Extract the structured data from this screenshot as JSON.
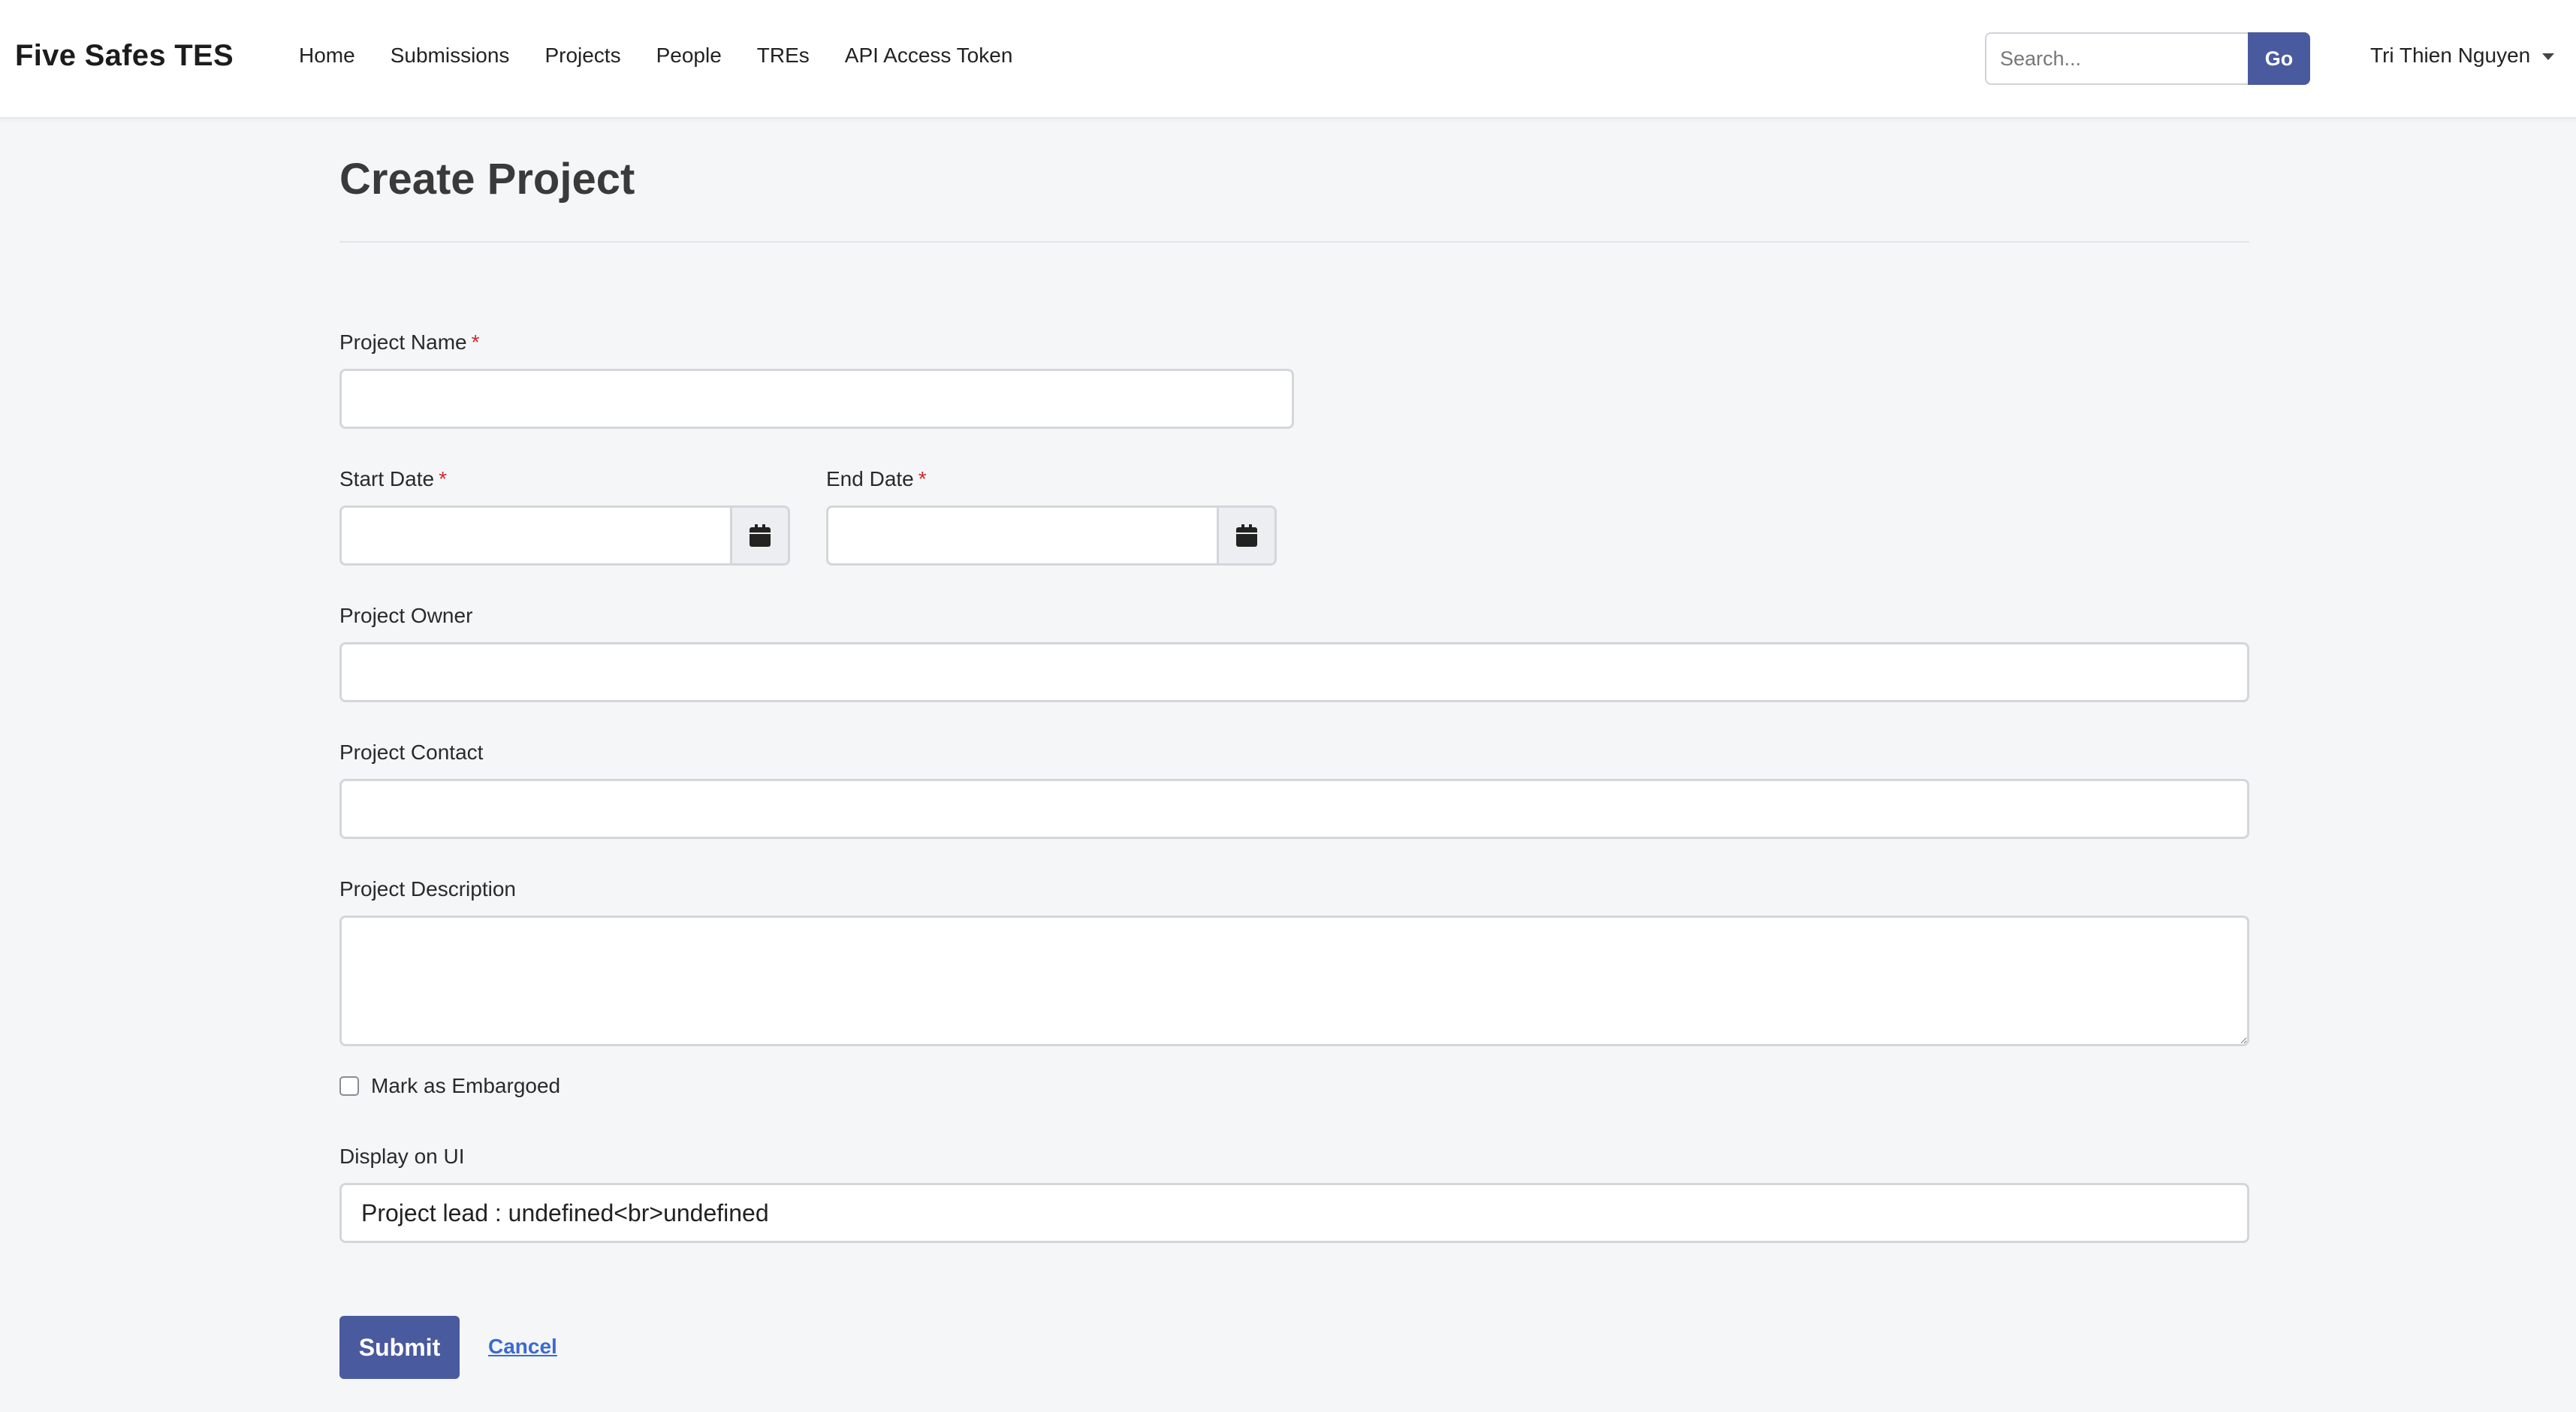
{
  "navbar": {
    "brand": "Five Safes TES",
    "links": [
      "Home",
      "Submissions",
      "Projects",
      "People",
      "TREs",
      "API Access Token"
    ],
    "search": {
      "placeholder": "Search...",
      "value": ""
    },
    "go_label": "Go",
    "user_name": "Tri Thien Nguyen"
  },
  "page": {
    "title": "Create Project"
  },
  "form": {
    "required_marker": "*",
    "project_name": {
      "label": "Project Name",
      "value": ""
    },
    "start_date": {
      "label": "Start Date",
      "value": ""
    },
    "end_date": {
      "label": "End Date",
      "value": ""
    },
    "project_owner": {
      "label": "Project Owner",
      "value": ""
    },
    "project_contact": {
      "label": "Project Contact",
      "value": ""
    },
    "project_description": {
      "label": "Project Description",
      "value": ""
    },
    "embargoed": {
      "label": "Mark as Embargoed",
      "checked": false
    },
    "display_on_ui": {
      "label": "Display on UI",
      "value": "Project lead : undefined<br>undefined"
    },
    "submit_label": "Submit",
    "cancel_label": "Cancel"
  },
  "colors": {
    "primary": "#4a5a9e",
    "required": "#d62828",
    "link": "#3b6ad1",
    "background": "#f5f6f8"
  },
  "icons": {
    "calendar": "calendar-icon",
    "user_caret": "caret-down-icon"
  }
}
